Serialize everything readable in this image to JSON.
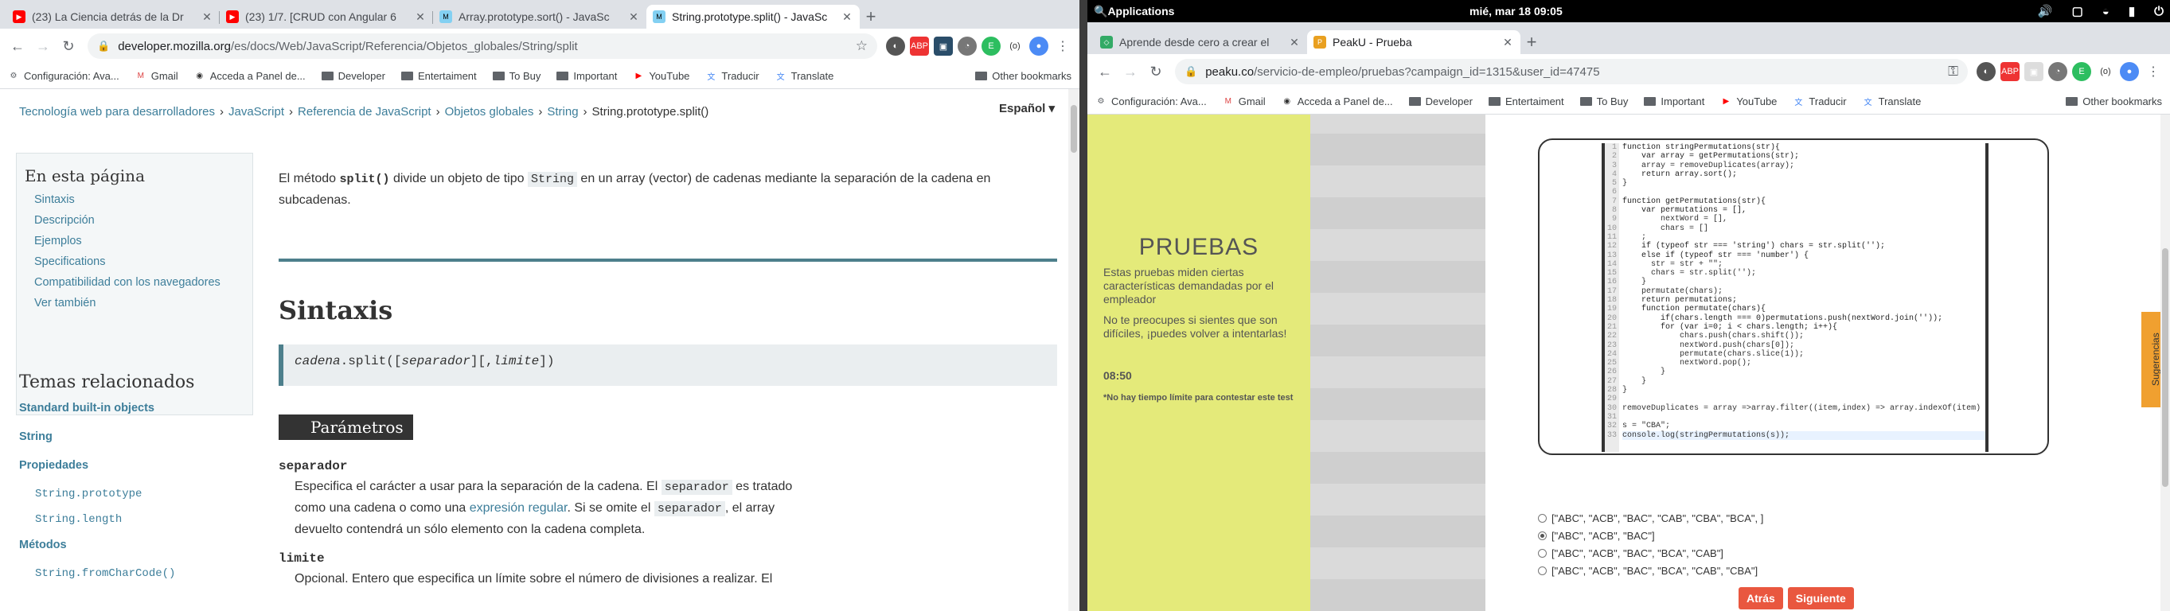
{
  "left": {
    "tabs": [
      {
        "title": "(23) La Ciencia detrás de la Dr",
        "icon": "youtube-icon"
      },
      {
        "title": "(23) 1/7. [CRUD con Angular 6",
        "icon": "youtube-icon"
      },
      {
        "title": "Array.prototype.sort() - JavaSc",
        "icon": "mdn-icon"
      },
      {
        "title": "String.prototype.split() - JavaSc",
        "icon": "mdn-icon"
      }
    ],
    "url_host": "developer.mozilla.org",
    "url_path": "/es/docs/Web/JavaScript/Referencia/Objetos_globales/String/split",
    "bookmarks": [
      "Configuración: Ava...",
      "Gmail",
      "Acceda a Panel de...",
      "Developer",
      "Entertaiment",
      "To Buy",
      "Important",
      "YouTube",
      "Traducir",
      "Translate"
    ],
    "other_bookmarks": "Other bookmarks",
    "breadcrumb": [
      "Tecnología web para desarrolladores",
      "JavaScript",
      "Referencia de JavaScript",
      "Objetos globales",
      "String",
      "String.prototype.split()"
    ],
    "language": "Español",
    "toc_title": "En esta página",
    "toc": [
      "Sintaxis",
      "Descripción",
      "Ejemplos",
      "Specifications",
      "Compatibilidad con los navegadores",
      "Ver también"
    ],
    "related_title": "Temas relacionados",
    "related_std": "Standard built-in objects",
    "related_string": "String",
    "related_props": "Propiedades",
    "related_props_items": [
      "String.prototype",
      "String.length"
    ],
    "related_methods": "Métodos",
    "related_methods_items": [
      "String.fromCharCode()"
    ],
    "intro_a": "El método ",
    "intro_code1": "split()",
    "intro_b": " divide un objeto de tipo ",
    "intro_code2": "String",
    "intro_c": " en un array (vector) de cadenas mediante la separación de la cadena en subcadenas.",
    "syntax_heading": "Sintaxis",
    "syntax_obj": "cadena",
    "syntax_mid": ".split([",
    "syntax_sep": "separador",
    "syntax_mid2": "][,",
    "syntax_lim": "limite",
    "syntax_end": "])",
    "params_heading": "Parámetros",
    "p1_name": "separador",
    "p1_a": "Especifica el carácter a usar para la separación de la cadena. El ",
    "p1_code": "separador",
    "p1_b": " es tratado como una cadena o como una ",
    "p1_link": "expresión regular",
    "p1_c": ". Si se omite el ",
    "p1_code2": "separador",
    "p1_d": ", el array devuelto contendrá un sólo elemento con la cadena completa.",
    "p2_name": "limite",
    "p2_a": "Opcional. Entero que especifica un límite sobre el número de divisiones a realizar. El"
  },
  "right": {
    "os_apps": "Applications",
    "os_clock": "mié, mar 18  09:05",
    "tabs": [
      {
        "title": "Aprende desde cero a crear el",
        "icon": "web-icon"
      },
      {
        "title": "PeakU - Prueba",
        "icon": "peaku-icon"
      }
    ],
    "url_host": "peaku.co",
    "url_path": "/servicio-de-empleo/pruebas?campaign_id=1315&user_id=47475",
    "bookmarks": [
      "Configuración: Ava...",
      "Gmail",
      "Acceda a Panel de...",
      "Developer",
      "Entertaiment",
      "To Buy",
      "Important",
      "YouTube",
      "Traducir",
      "Translate"
    ],
    "other_bookmarks": "Other bookmarks",
    "panel_title": "PRUEBAS",
    "panel_sub": "Estas pruebas miden ciertas características demandadas por el empleador",
    "panel_sub2": "No te preocupes si sientes que son difíciles, ¡puedes volver a intentarlas!",
    "timer": "08:50",
    "note": "*No hay tiempo límite para contestar este test",
    "code_lines": [
      "function stringPermutations(str){",
      "    var array = getPermutations(str);",
      "    array = removeDuplicates(array);",
      "    return array.sort();",
      "}",
      "",
      "function getPermutations(str){",
      "    var permutations = [],",
      "        nextWord = [],",
      "        chars = []",
      "    ;",
      "    if (typeof str === 'string') chars = str.split('');",
      "    else if (typeof str === 'number') {",
      "      str = str + \"\";",
      "      chars = str.split('');",
      "    }",
      "    permutate(chars);",
      "    return permutations;",
      "    function permutate(chars){",
      "        if(chars.length === 0)permutations.push(nextWord.join(''));",
      "        for (var i=0; i < chars.length; i++){",
      "            chars.push(chars.shift());",
      "            nextWord.push(chars[0]);",
      "            permutate(chars.slice(1));",
      "            nextWord.pop();",
      "        }",
      "    }",
      "}",
      "",
      "removeDuplicates = array =>array.filter((item,index) => array.indexOf(item) == index)",
      "",
      "s = \"CBA\";",
      "console.log(stringPermutations(s));"
    ],
    "answers": [
      "[\"ABC\", \"ACB\", \"BAC\", \"CAB\", \"CBA\", \"BCA\", ]",
      "[\"ABC\", \"ACB\", \"BAC\"]",
      "[\"ABC\", \"ACB\", \"BAC\", \"BCA\", \"CAB\"]",
      "[\"ABC\", \"ACB\", \"BAC\", \"BCA\", \"CAB\", \"CBA\"]"
    ],
    "selected_answer": 1,
    "btn_back": "Atrás",
    "btn_next": "Siguiente",
    "suggestions": "Sugerencias"
  },
  "colors": {
    "mdn_link": "#3d7e9a",
    "peaku_accent": "#e9573f",
    "panel_bg": "#e4ea7a"
  }
}
